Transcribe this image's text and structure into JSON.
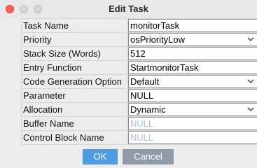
{
  "window": {
    "title": "Edit Task"
  },
  "form": {
    "rows": [
      {
        "label": "Task Name",
        "value": "monitorTask",
        "dropdown": false,
        "placeholder": false
      },
      {
        "label": "Priority",
        "value": "osPriorityLow",
        "dropdown": true,
        "placeholder": false
      },
      {
        "label": "Stack Size (Words)",
        "value": "512",
        "dropdown": false,
        "placeholder": false
      },
      {
        "label": "Entry Function",
        "value": "StartmonitorTask",
        "dropdown": false,
        "placeholder": false
      },
      {
        "label": "Code Generation Option",
        "value": "Default",
        "dropdown": true,
        "placeholder": false
      },
      {
        "label": "Parameter",
        "value": "NULL",
        "dropdown": false,
        "placeholder": false
      },
      {
        "label": "Allocation",
        "value": "Dynamic",
        "dropdown": true,
        "placeholder": false
      },
      {
        "label": "Buffer Name",
        "value": "NULL",
        "dropdown": false,
        "placeholder": true
      },
      {
        "label": "Control Block Name",
        "value": "NULL",
        "dropdown": false,
        "placeholder": true
      }
    ]
  },
  "buttons": {
    "ok_label": "OK",
    "cancel_label": "Cancel"
  },
  "colors": {
    "ok": "#4d9de0",
    "cancel": "#8f9aa6",
    "close": "#ff5f57",
    "placeholder_text": "#a9bed8"
  }
}
